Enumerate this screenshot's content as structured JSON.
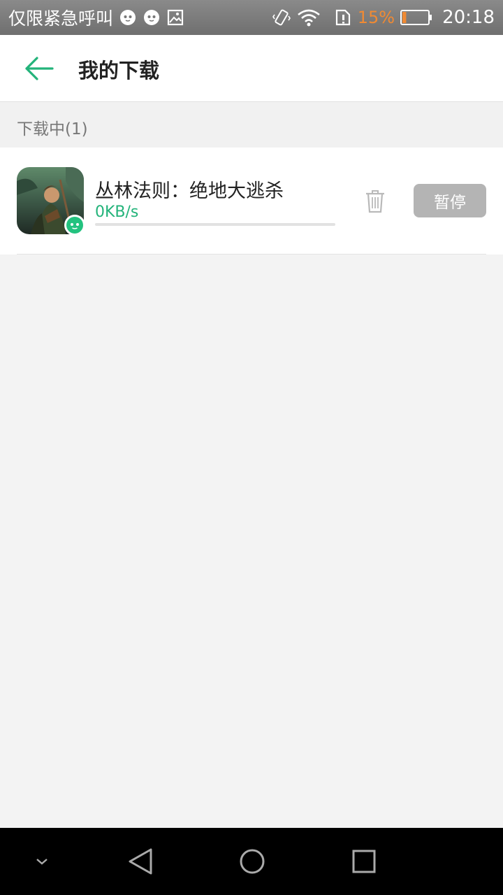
{
  "status_bar": {
    "carrier": "仅限紧急呼叫",
    "left_icons": [
      "app-notification-icon",
      "app-notification-icon",
      "image-icon"
    ],
    "right_icons": [
      "vibrate-icon",
      "wifi-icon",
      "sim-alert-icon"
    ],
    "battery_percent": "15%",
    "battery_color": "#f08a33",
    "battery_level": 0.15,
    "time": "20:18"
  },
  "app_bar": {
    "title": "我的下载",
    "accent_color": "#23b37a"
  },
  "downloads": {
    "section_title": "下载中(1)",
    "items": [
      {
        "name": "丛林法则：绝地大逃杀",
        "speed": "0KB/s",
        "progress": 0,
        "delete_icon": "trash-icon",
        "action_label": "暂停"
      }
    ]
  },
  "nav_bar": {
    "buttons": [
      "collapse-icon",
      "back-icon",
      "home-icon",
      "recents-icon"
    ]
  }
}
